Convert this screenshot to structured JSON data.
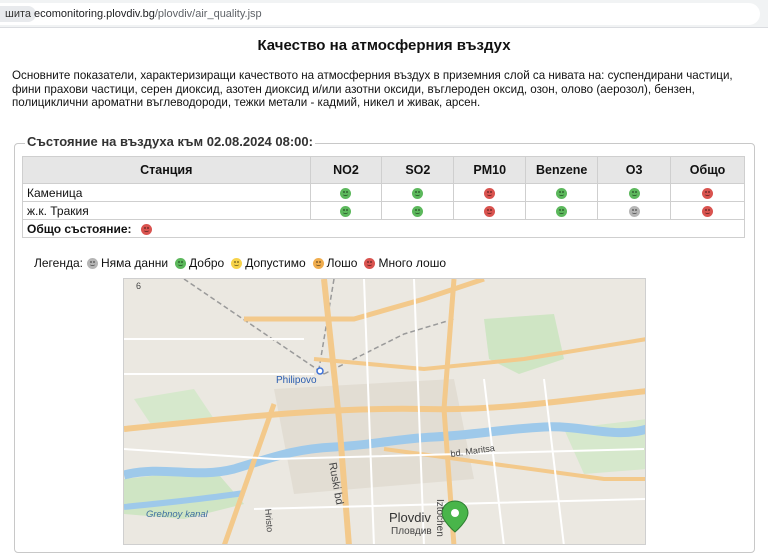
{
  "browser": {
    "tab_chip": "шита",
    "url_host": "ecomonitoring.plovdiv.bg",
    "url_path": "/plovdiv/air_quality.jsp"
  },
  "page": {
    "title": "Качество на атмосферния въздух",
    "intro": "Основните показатели, характеризиращи качеството на атмосферния въздух в приземния слой са нивата на: суспендирани частици, фини прахови частици, серен диоксид, азотен диоксид и/или азотни оксиди, въглероден оксид, озон, олово (аерозол), бензен, полициклични ароматни въглеводороди, тежки метали - кадмий, никел и живак, арсен.",
    "status_heading": "Състояние на въздуха към 02.08.2024 08:00:"
  },
  "table": {
    "headers": [
      "Станция",
      "NO2",
      "SO2",
      "PM10",
      "Benzene",
      "O3",
      "Общо"
    ],
    "rows": [
      {
        "station": "Каменица",
        "statuses": [
          "good",
          "good",
          "verybad",
          "good",
          "good",
          "verybad"
        ]
      },
      {
        "station": "ж.к. Тракия",
        "statuses": [
          "good",
          "good",
          "verybad",
          "good",
          "nodata",
          "verybad"
        ]
      }
    ],
    "overall_label": "Общо състояние:",
    "overall_status": "verybad"
  },
  "legend": {
    "label": "Легенда:",
    "items": [
      {
        "status": "nodata",
        "label": "Няма данни",
        "color": "#b5b5b5"
      },
      {
        "status": "good",
        "label": "Добро",
        "color": "#5cb85c"
      },
      {
        "status": "acceptable",
        "label": "Допустимо",
        "color": "#f7d34a"
      },
      {
        "status": "bad",
        "label": "Лошо",
        "color": "#f0ad4e"
      },
      {
        "status": "verybad",
        "label": "Много лошо",
        "color": "#d9534f"
      }
    ]
  },
  "map": {
    "labels": {
      "philipovo": "Philipovo",
      "maritsa": "bd. Maritsa",
      "ruski": "Ruski bd",
      "grebnoy": "Grebnoy kanal",
      "plovdiv_latin": "Plovdiv",
      "plovdiv_cyr": "Пловдив",
      "iztochen": "Iztochen",
      "hristo": "Hristo",
      "shest": "6"
    }
  }
}
